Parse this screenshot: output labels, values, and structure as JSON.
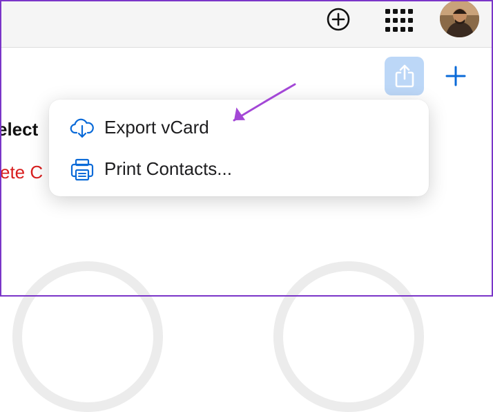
{
  "colors": {
    "accent": "#0a6ad8",
    "share_button_bg": "#bcd7f7",
    "delete_red": "#d81e1e",
    "annotation_purple": "#a347d6",
    "frame_border": "#7a35c8"
  },
  "topbar": {
    "add_icon": "plus-circle-icon",
    "apps_icon": "grid-icon",
    "avatar_icon": "user-avatar"
  },
  "toolbar": {
    "share_icon": "share-icon",
    "add_icon": "plus-icon"
  },
  "main": {
    "heading_partial": "elect",
    "delete_partial": "ete C"
  },
  "menu": {
    "items": [
      {
        "label": "Export vCard",
        "icon": "cloud-download-icon"
      },
      {
        "label": "Print Contacts...",
        "icon": "printer-icon"
      }
    ]
  }
}
